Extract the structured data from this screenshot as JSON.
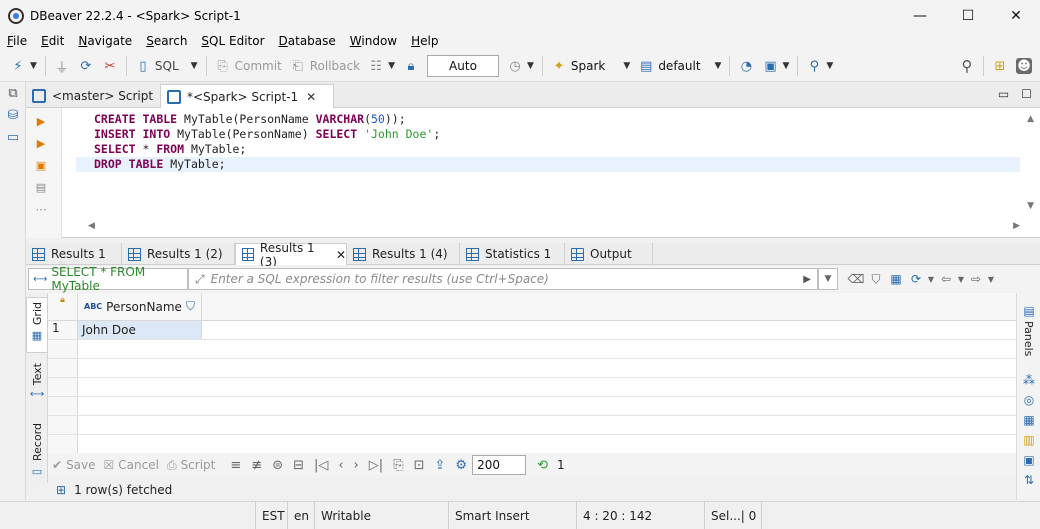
{
  "window": {
    "title": "DBeaver 22.2.4 - <Spark> Script-1",
    "controls": {
      "minimize": "—",
      "maximize": "☐",
      "close": "✕"
    }
  },
  "menu": [
    "File",
    "Edit",
    "Navigate",
    "Search",
    "SQL Editor",
    "Database",
    "Window",
    "Help"
  ],
  "toolbar": {
    "sql_label": "SQL",
    "commit_label": "Commit",
    "rollback_label": "Rollback",
    "transaction_mode": "Auto",
    "connection_label": "Spark",
    "schema_label": "default"
  },
  "editor_tabs": [
    {
      "label": "<master> Script"
    },
    {
      "label": "*<Spark> Script-1",
      "close": "✕"
    }
  ],
  "editor": {
    "lines": [
      [
        {
          "t": "CREATE",
          "c": "kw"
        },
        {
          "t": " "
        },
        {
          "t": "TABLE",
          "c": "kw"
        },
        {
          "t": " MyTable(PersonName "
        },
        {
          "t": "VARCHAR",
          "c": "kw"
        },
        {
          "t": "("
        },
        {
          "t": "50",
          "c": "num"
        },
        {
          "t": "));"
        }
      ],
      [
        {
          "t": "INSERT",
          "c": "kw"
        },
        {
          "t": " "
        },
        {
          "t": "INTO",
          "c": "kw"
        },
        {
          "t": " MyTable(PersonName) "
        },
        {
          "t": "SELECT",
          "c": "kw"
        },
        {
          "t": " "
        },
        {
          "t": "'John Doe'",
          "c": "str"
        },
        {
          "t": ";"
        }
      ],
      [
        {
          "t": "SELECT",
          "c": "kw"
        },
        {
          "t": " * "
        },
        {
          "t": "FROM",
          "c": "kw"
        },
        {
          "t": " MyTable;"
        }
      ],
      [
        {
          "t": "DROP",
          "c": "kw"
        },
        {
          "t": " "
        },
        {
          "t": "TABLE",
          "c": "kw"
        },
        {
          "t": " MyTable;"
        }
      ]
    ]
  },
  "result_tabs": [
    {
      "label": "Results 1"
    },
    {
      "label": "Results 1 (2)"
    },
    {
      "label": "Results 1 (3)",
      "close": "✕"
    },
    {
      "label": "Results 1 (4)"
    },
    {
      "label": "Statistics 1"
    },
    {
      "label": "Output"
    }
  ],
  "filter": {
    "query_label": "SELECT * FROM MyTable",
    "placeholder": "Enter a SQL expression to filter results (use Ctrl+Space)"
  },
  "side_tabs": [
    "Grid",
    "Text",
    "Record"
  ],
  "grid": {
    "columns": [
      {
        "type": "ABC",
        "name": "PersonName"
      }
    ],
    "rows": [
      {
        "num": "1",
        "cells": [
          "John Doe"
        ]
      }
    ]
  },
  "right_panel": {
    "label": "Panels"
  },
  "grid_toolbar": {
    "save_label": "Save",
    "cancel_label": "Cancel",
    "script_label": "Script",
    "fetch_size": "200",
    "row_count": "1"
  },
  "fetch_status": "1 row(s) fetched",
  "statusbar": {
    "timezone": "EST",
    "locale": "en",
    "mode": "Writable",
    "insert_mode": "Smart Insert",
    "position": "4 : 20 : 142",
    "selection": "Sel...| 0"
  },
  "colors": {
    "keyword": "#7f0055",
    "string": "#2a9d2a",
    "number": "#1a55cc",
    "accent": "#2b6cb0",
    "selected_cell": "#dce8f6"
  }
}
